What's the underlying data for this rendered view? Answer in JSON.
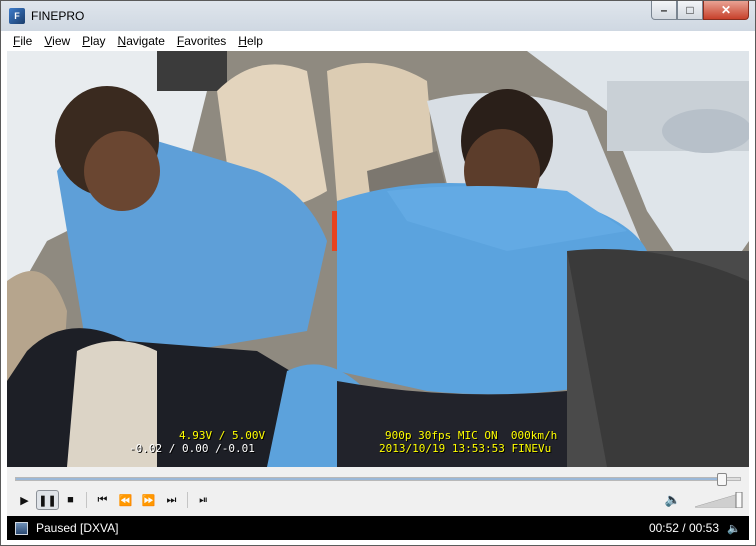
{
  "window": {
    "title": "FINEPRO",
    "app_icon": "F"
  },
  "menu": {
    "items": [
      {
        "accel": "F",
        "rest": "ile"
      },
      {
        "accel": "V",
        "rest": "iew"
      },
      {
        "accel": "P",
        "rest": "lay"
      },
      {
        "accel": "N",
        "rest": "avigate"
      },
      {
        "accel": "F",
        "rest": "avorites"
      },
      {
        "accel": "H",
        "rest": "elp"
      }
    ]
  },
  "video": {
    "osd_voltage": "4.93V / 5.00V",
    "osd_gsensor": "-0.02 / 0.00 /-0.01",
    "osd_status": "900p 30fps MIC ON  000km/h",
    "osd_datetime": "2013/10/19 13:53:53 FINEVu"
  },
  "playback": {
    "progress": 0.982,
    "volume": 1.0,
    "buttons": [
      "play-icon",
      "pause-icon",
      "stop-icon",
      "skip-back-icon",
      "rewind-icon",
      "fast-forward-icon",
      "skip-forward-icon",
      "frame-step-icon",
      "speaker-icon"
    ]
  },
  "status": {
    "state": "Paused [DXVA]",
    "time": "00:52 / 00:53"
  },
  "colors": {
    "osd": "#ffff00",
    "status_bg": "#000000",
    "title_bg": "#d6dde6"
  }
}
